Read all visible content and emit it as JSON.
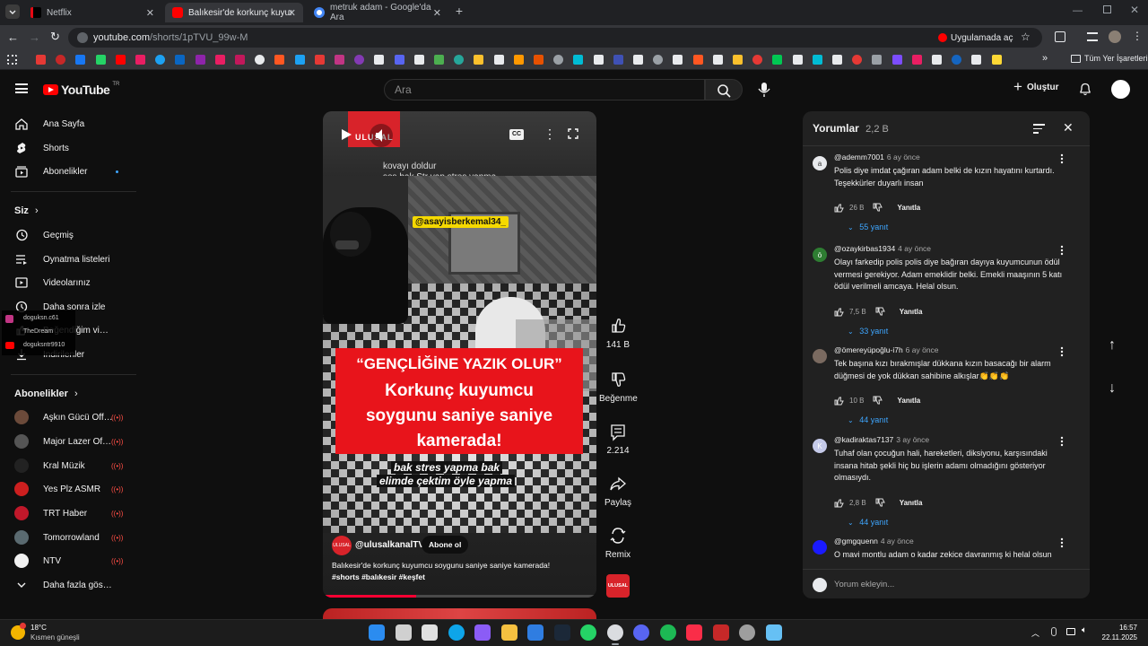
{
  "browser": {
    "tabs": [
      {
        "title": "Netflix",
        "active": false
      },
      {
        "title": "Balıkesir'de korkunç kuyumcu s",
        "active": true
      },
      {
        "title": "metruk adam - Google'da Ara",
        "active": false
      }
    ],
    "url": {
      "host": "youtube.com",
      "path": "/shorts/1pTVU_99w-M"
    },
    "open_in_app": "Uygulamada aç",
    "all_bookmarks": "Tüm Yer İşaretleri"
  },
  "header": {
    "logo": "YouTube",
    "logo_suffix": "TR",
    "search_placeholder": "Ara",
    "create_label": "Oluştur"
  },
  "sidebar": {
    "main": [
      {
        "label": "Ana Sayfa",
        "icon": "home-icon"
      },
      {
        "label": "Shorts",
        "icon": "shorts-icon"
      },
      {
        "label": "Abonelikler",
        "icon": "subscriptions-icon"
      }
    ],
    "you_heading": "Siz",
    "you": [
      {
        "label": "Geçmiş",
        "icon": "history-icon"
      },
      {
        "label": "Oynatma listeleri",
        "icon": "playlists-icon"
      },
      {
        "label": "Videolarınız",
        "icon": "your-videos-icon"
      },
      {
        "label": "Daha sonra izle",
        "icon": "watch-later-icon"
      },
      {
        "label": "Beğendiğim videolar",
        "icon": "liked-icon"
      },
      {
        "label": "İndirilenler",
        "icon": "downloads-icon"
      }
    ],
    "subs_heading": "Abonelikler",
    "subs": [
      {
        "label": "Aşkın Gücü Offic...",
        "color": "#6b4a3a"
      },
      {
        "label": "Major Lazer Offi...",
        "color": "#555555"
      },
      {
        "label": "Kral Müzik",
        "color": "#222222"
      },
      {
        "label": "Yes Plz ASMR",
        "color": "#cc1f1f"
      },
      {
        "label": "TRT Haber",
        "color": "#c0182a"
      },
      {
        "label": "Tomorrowland",
        "color": "#5a6a70"
      },
      {
        "label": "NTV",
        "color": "#f1f1f1"
      }
    ],
    "show_more": "Daha fazla göster",
    "overlay_handles": [
      "doguksn.c61",
      "TheDream",
      "doguksntr9910"
    ]
  },
  "video": {
    "top_caption_line1": "kovayı doldur",
    "top_caption_line2": "ses bak Str yap stres yapma",
    "brand_tag": "ULUSAL",
    "watermark": "@asayisberkemal34_",
    "headline_quote": "“GENÇLİĞİNE YAZIK OLUR”",
    "headline_line2": "Korkunç kuyumcu",
    "headline_line3": "soygunu saniye saniye",
    "headline_line4": "kamerada!",
    "sub_caption_line1": "bak stres yapma bak",
    "sub_caption_line2": "elimde çektim öyle yapma",
    "channel_handle": "@ulusalkanalTV",
    "subscribe": "Abone ol",
    "description": "Balıkesir'de korkunç kuyumcu soygunu saniye saniye kamerada!",
    "hashtags": "#shorts #balıkesir #keşfet",
    "progress": 0.34,
    "cc_label": "CC"
  },
  "actions": {
    "likes": "141 B",
    "dislike": "Beğenme",
    "comments": "2.214",
    "share": "Paylaş",
    "remix": "Remix",
    "channel_badge": "ULUSAL"
  },
  "comments": {
    "title": "Yorumlar",
    "count": "2,2 B",
    "reply_label": "Yanıtla",
    "input_placeholder": "Yorum ekleyin...",
    "items": [
      {
        "user": "@ademm7001",
        "time": "6 ay önce",
        "text": "Polis diye imdat çağıran adam belki de kızın hayatını kurtardı. Teşekkürler duyarlı insan",
        "likes": "26 B",
        "replies": "55 yanıt",
        "avatar": "a",
        "avatar_color": "#e8eaed"
      },
      {
        "user": "@ozaykirbas1934",
        "time": "4 ay önce",
        "text": "Olayı farkedip polis polis diye bağıran dayıya kuyumcunun ödül vermesi gerekiyor. Adam emeklidir belki. Emekli maaşının 5 katı ödül verilmeli amcaya. Helal olsun.",
        "likes": "7,5 B",
        "replies": "33 yanıt",
        "avatar": "ö",
        "avatar_color": "#2e7d32"
      },
      {
        "user": "@ömereyüpoğlu-i7h",
        "time": "6 ay önce",
        "text": "Tek başına kızı bırakmışlar dükkana kızın basacağı bir alarm düğmesi de yok dükkan sahibine alkışlar👏👏👏",
        "likes": "10 B",
        "replies": "44 yanıt",
        "avatar": "",
        "avatar_color": "#7a6a60"
      },
      {
        "user": "@kadiraktas7137",
        "time": "3 ay önce",
        "text": "Tuhaf olan çocuğun hali, hareketleri, diksiyonu, karşısındaki insana hitab şekli hiç bu işlerin adamı olmadığını gösteriyor olmasıydı.",
        "likes": "2,8 B",
        "replies": "44 yanıt",
        "avatar": "K",
        "avatar_color": "#c5cae9"
      },
      {
        "user": "@gmgquenn",
        "time": "4 ay önce",
        "text": "O mavi montlu adam o kadar zekice davranmış ki helal olsun",
        "likes": "",
        "replies": "",
        "avatar": "",
        "avatar_color": "#1a1aff"
      }
    ]
  },
  "taskbar": {
    "weather_temp": "18°C",
    "weather_desc": "Kısmen güneşli",
    "time": "16:57",
    "date": "22.11.2025"
  }
}
